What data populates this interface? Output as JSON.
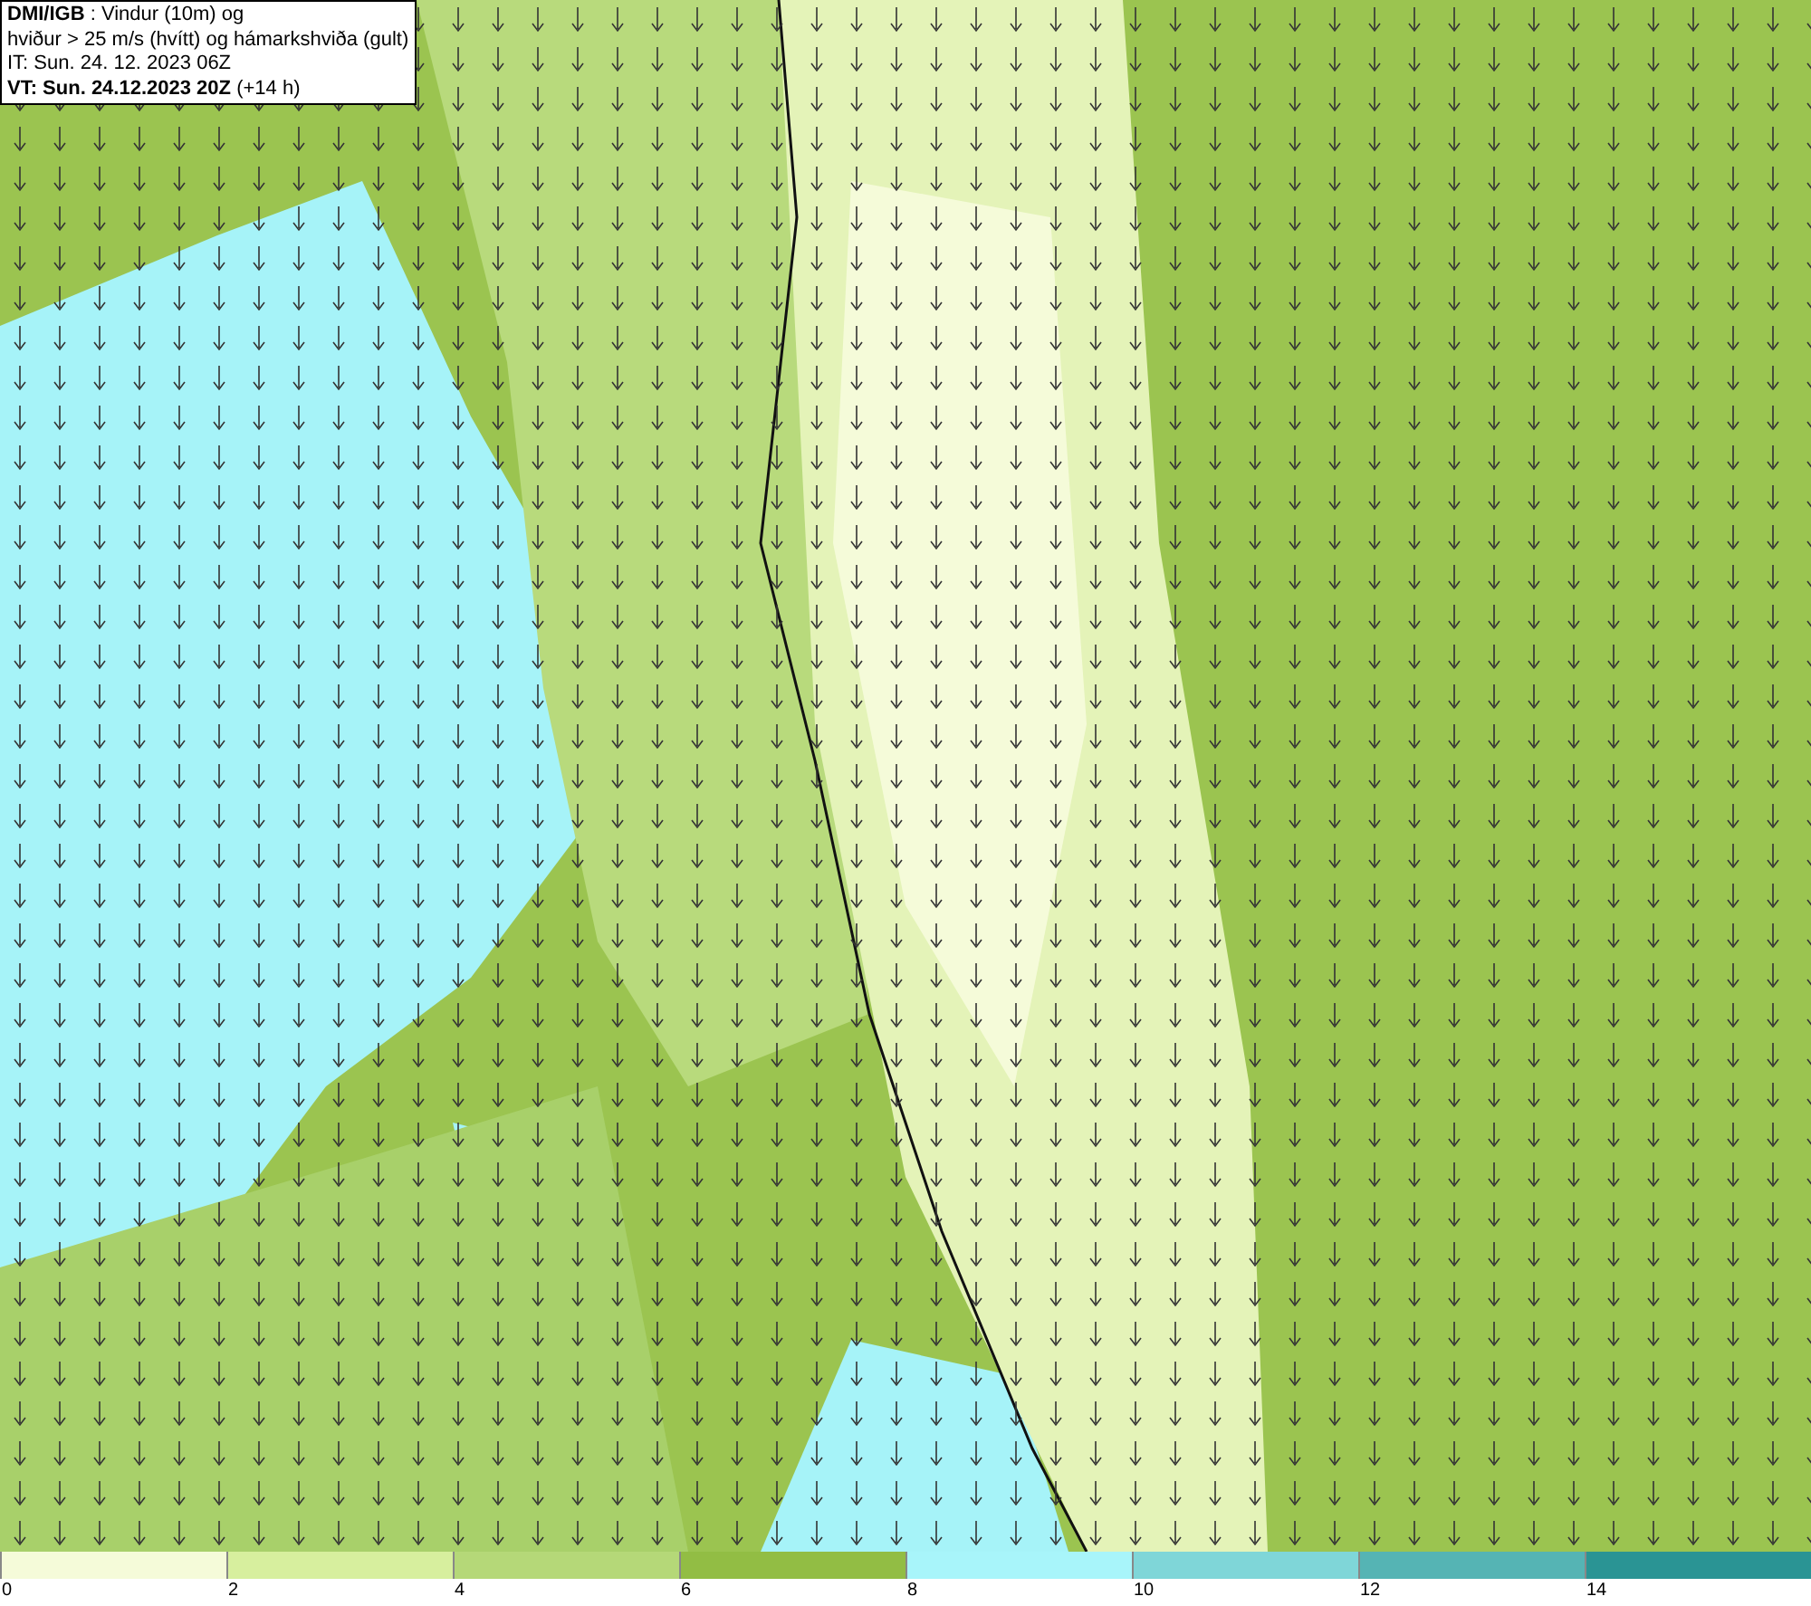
{
  "info_box": {
    "lines": [
      "**DMI/IGB** : Vindur (10m) og",
      "hviður > 25 m/s (hvítt) og hámarkshviða (gult)",
      "IT: Sun. 24. 12. 2023 06Z",
      "**VT: Sun. 24.12.2023 20Z** (+14 h)"
    ]
  },
  "legend": {
    "bands": [
      {
        "label": "0",
        "color": "#f5fbd9"
      },
      {
        "label": "2",
        "color": "#d7ef9e"
      },
      {
        "label": "4",
        "color": "#b5d878"
      },
      {
        "label": "6",
        "color": "#92bd44"
      },
      {
        "label": "8",
        "color": "#a8f5fa"
      },
      {
        "label": "10",
        "color": "#7fd6d8"
      },
      {
        "label": "12",
        "color": "#55b4b4"
      },
      {
        "label": "14",
        "color": "#2a9494"
      }
    ]
  }
}
